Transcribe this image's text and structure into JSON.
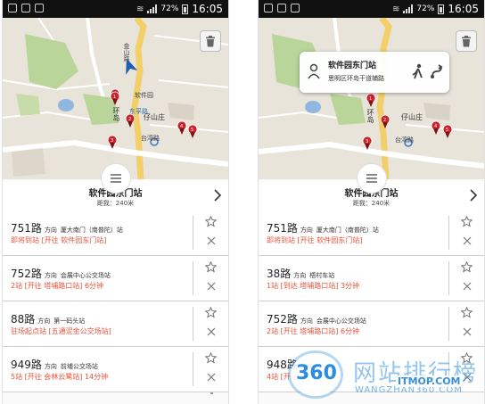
{
  "status_bar": {
    "battery": "72%",
    "time": "16:05"
  },
  "map_labels": {
    "jinshan_road": "金山路",
    "ruanjian_park": "软件园",
    "dongfu_road": "东孚路",
    "huandao": "环岛",
    "taiwan_road": "台湾路",
    "zai_shan_zhuang": "仔山庄"
  },
  "popup": {
    "title": "软件园东门站",
    "subtitle": "思明区环岛干道辅路"
  },
  "stop": {
    "name": "软件园东门站",
    "distance": "距我：240米"
  },
  "left_routes": [
    {
      "number": "751路",
      "direction_label": "方向",
      "direction": "厦大南门（南普陀）站",
      "status": "即将到站 [开往 软件园东门站]"
    },
    {
      "number": "752路",
      "direction_label": "方向",
      "direction": "会展中心公交场站",
      "status": "2站 [开往 塔埔路口站]  6分钟"
    },
    {
      "number": "88路",
      "direction_label": "方向",
      "direction": "第一码头站",
      "status": "驻场起点站 [五通泥金公交场站]"
    },
    {
      "number": "949路",
      "direction_label": "方向",
      "direction": "前埔公交场站",
      "status": "5站 [开往 会林云鹭站]  14分钟"
    }
  ],
  "right_routes": [
    {
      "number": "751路",
      "direction_label": "方向",
      "direction": "厦大南门（南普陀）站",
      "status": "即将到站 [开往 软件园东门站]"
    },
    {
      "number": "38路",
      "direction_label": "方向",
      "direction": "梧村车站",
      "status": "1站 [到达 塔埔路口站]  3分钟"
    },
    {
      "number": "752路",
      "direction_label": "方向",
      "direction": "会展中心公交场站",
      "status": "2站 [开往 塔埔路口站]  6分钟"
    },
    {
      "number": "948路",
      "direction_label": "方向",
      "direction": "",
      "status": "4站 [开往 ..."
    }
  ],
  "watermark": {
    "brand": "360",
    "text": "网站排行榜",
    "url": "WANGZHAN360.COM",
    "corner": "ITMOP.COM"
  },
  "colors": {
    "accent_red": "#e8533b",
    "pin_red": "#c8232b",
    "nav_blue": "#1a5fb4",
    "road_yellow": "#f3cf6a",
    "park_green": "#b9d59a"
  },
  "icons": {
    "trash": "trash-icon",
    "star": "star-icon",
    "close": "close-icon",
    "chevron": "chevron-right-icon",
    "person": "person-icon",
    "walk": "walk-icon",
    "route": "route-icon",
    "pin": "map-pin-icon",
    "location": "location-arrow-icon",
    "menu": "menu-icon"
  }
}
